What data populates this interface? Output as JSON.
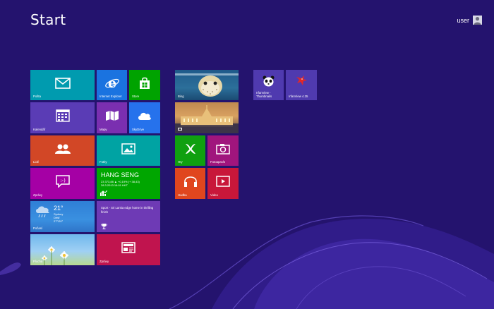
{
  "screen": {
    "title": "Start",
    "user": "user"
  },
  "tiles": {
    "mail": "Pošta",
    "ie": "Internet Explorer",
    "store": "Store",
    "calendar": "Kalendář",
    "maps": "Mapy",
    "skydrive": "SkyDrive",
    "people": "Lidé",
    "photos": "Fotky",
    "messaging": "Zprávy",
    "finance": {
      "title": "HANG SENG",
      "line1": "23 ‎373,88 ▲ +0,19% (+ 38,43)",
      "line2": "28.3.2013 16:01 HKT"
    },
    "weather": {
      "label": "Počasí",
      "temp": "21°",
      "city": "Sydney",
      "cond": "Déšť",
      "range": "27°/20°"
    },
    "sport": {
      "text": "Sport - Sri Lanka edge home in thrilling finish"
    },
    "desktop": "Plocha",
    "news": "Zprávy",
    "bing": "Bing",
    "games": "Hry",
    "camera": "Fotoaparát",
    "music": "Hudba",
    "video": "Video",
    "irfanview_thumbs": "IrfanView - Thumbnails",
    "irfanview": "IrfanView 4.35"
  }
}
